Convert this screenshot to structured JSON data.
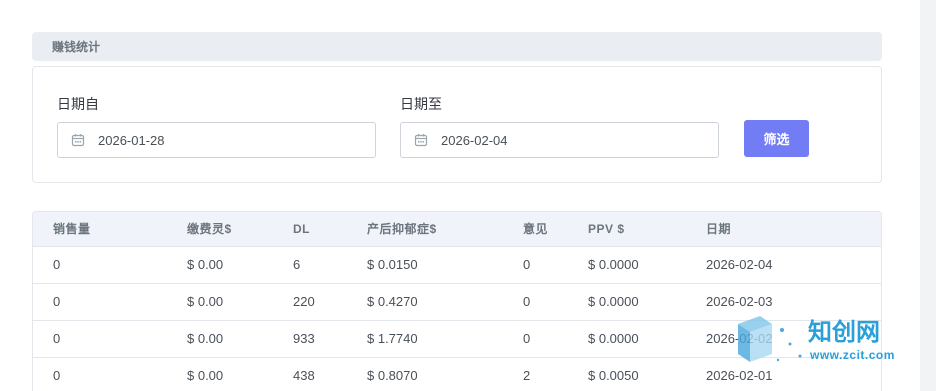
{
  "section": {
    "title": "赚钱统计"
  },
  "filter": {
    "from_label": "日期自",
    "from_value": "2026-01-28",
    "to_label": "日期至",
    "to_value": "2026-02-04",
    "button_label": "筛选"
  },
  "table": {
    "headers": [
      "销售量",
      "缴费灵$",
      "DL",
      "产后抑郁症$",
      "意见",
      "PPV $",
      "日期"
    ],
    "rows": [
      [
        "0",
        "$ 0.00",
        "6",
        "$ 0.0150",
        "0",
        "$ 0.0000",
        "2026-02-04"
      ],
      [
        "0",
        "$ 0.00",
        "220",
        "$ 0.4270",
        "0",
        "$ 0.0000",
        "2026-02-03"
      ],
      [
        "0",
        "$ 0.00",
        "933",
        "$ 1.7740",
        "0",
        "$ 0.0000",
        "2026-02-02"
      ],
      [
        "0",
        "$ 0.00",
        "438",
        "$ 0.8070",
        "2",
        "$ 0.0050",
        "2026-02-01"
      ]
    ]
  },
  "watermark": {
    "title": "知创网",
    "url": "www.zcit.com"
  },
  "colors": {
    "accent": "#727cf5",
    "watermark": "#2a9fd8"
  }
}
